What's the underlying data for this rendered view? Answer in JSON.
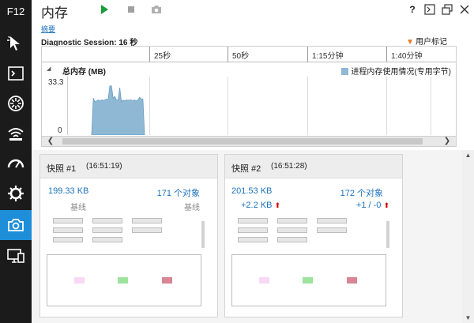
{
  "sidebar": {
    "title": "F12",
    "items": [
      {
        "icon": "dom-select-icon"
      },
      {
        "icon": "console-icon"
      },
      {
        "icon": "debugger-icon"
      },
      {
        "icon": "network-icon"
      },
      {
        "icon": "ui-responsiveness-icon"
      },
      {
        "icon": "profiler-icon"
      },
      {
        "icon": "memory-camera-icon",
        "active": true
      },
      {
        "icon": "emulation-icon"
      }
    ]
  },
  "titlebar": {
    "title": "内存",
    "help": "?",
    "colors": {
      "play": "#1a9e3c",
      "stop": "#a0a0a0"
    }
  },
  "summary": {
    "link": "摘要",
    "session": "Diagnostic Session: 16 秒",
    "user_mark": "用户标记",
    "user_mark_symbol": "▼"
  },
  "timeline": {
    "ticks": [
      "25秒",
      "50秒",
      "1:15分钟",
      "1:40分钟"
    ],
    "graph_title": "总内存 (MB)",
    "collapse_symbol": "◢",
    "legend": "进程内存使用情况(专用字节)",
    "y_max": "33.3",
    "y_min": "0",
    "scroll_left": "❮",
    "scroll_right": "❯"
  },
  "chart_data": {
    "type": "area",
    "title": "总内存 (MB)",
    "ylim": [
      0,
      33.3
    ],
    "series": [
      {
        "name": "进程内存使用情况(专用字节)",
        "values": [
          0,
          21,
          19,
          19.5,
          20,
          19.5,
          20,
          19.8,
          20,
          20.5,
          20,
          28,
          28,
          21,
          22,
          20,
          20,
          27,
          19,
          20,
          19.5,
          20,
          19.8,
          20,
          20,
          19.5,
          20,
          19.5,
          20,
          21.5,
          20.5,
          20.5,
          0
        ]
      }
    ],
    "colors": {
      "fill": "#8fb8d4",
      "line": "#6a9ec2"
    }
  },
  "snapshots": [
    {
      "name": "快照 #1",
      "time": "(16:51:19)",
      "size": "199.33 KB",
      "objects": "171 个对象",
      "base_left": "基线",
      "base_right": "基线"
    },
    {
      "name": "快照 #2",
      "time": "(16:51:28)",
      "size": "201.53 KB",
      "objects": "172 个对象",
      "delta_size": "+2.2 KB",
      "delta_objects": "+1 / -0",
      "arrow": "⬆"
    }
  ],
  "thumb_colors": [
    "#f7d9f5",
    "#9de29d",
    "#d98593"
  ]
}
